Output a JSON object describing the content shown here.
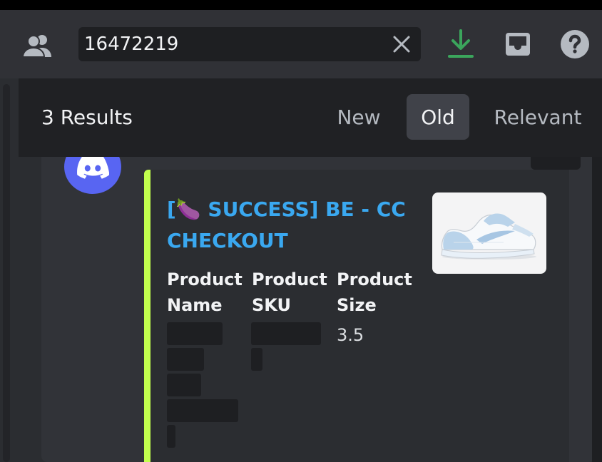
{
  "search": {
    "value": "16472219",
    "clear_icon": "close-icon"
  },
  "header_icons": {
    "members": "members-icon",
    "download": "download-icon",
    "inbox": "inbox-icon",
    "help": "help-icon"
  },
  "colors": {
    "download_green": "#3ba55c",
    "embed_accent": "#c1ff4d",
    "link_blue": "#3aa8f0",
    "discord_blurple": "#5865f2"
  },
  "results": {
    "count_label": "3 Results",
    "sort_tabs": [
      {
        "label": "New",
        "active": false
      },
      {
        "label": "Old",
        "active": true
      },
      {
        "label": "Relevant",
        "active": false
      }
    ]
  },
  "embed": {
    "title": "[🍆 SUCCESS] BE - CC CHECKOUT",
    "fields": [
      {
        "name": "Product Name",
        "value": ""
      },
      {
        "name": "Product SKU",
        "value": ""
      },
      {
        "name": "Product Size",
        "value": "3.5"
      }
    ],
    "thumbnail_icon": "sneaker-image"
  }
}
